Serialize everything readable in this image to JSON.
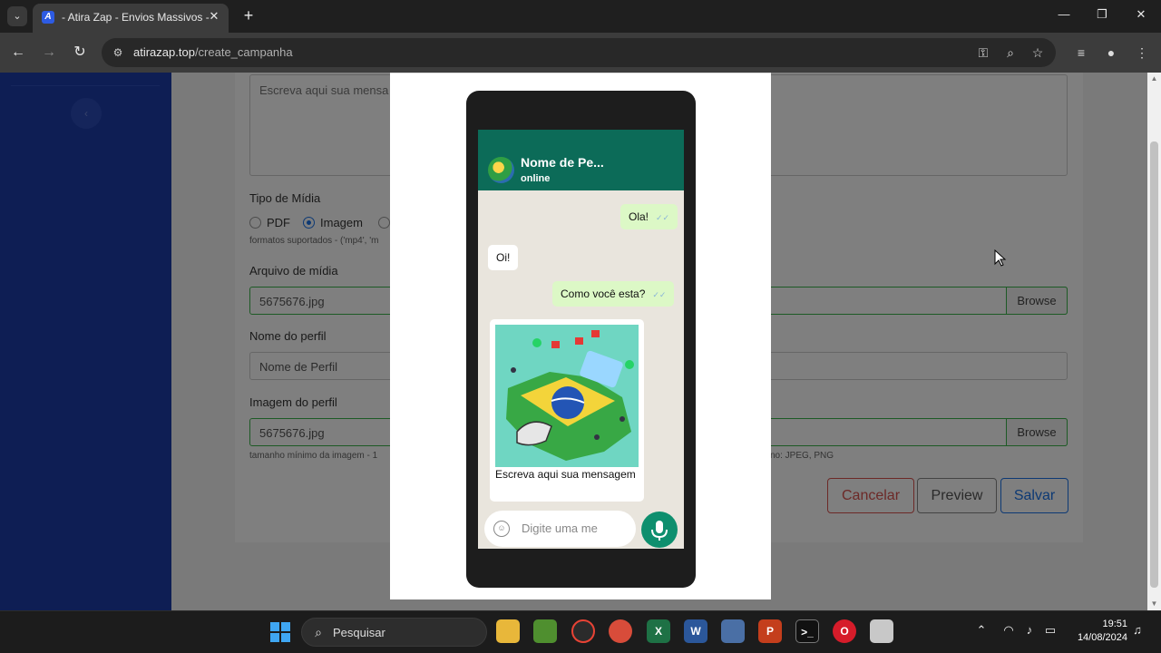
{
  "browser": {
    "tab_title": "- Atira Zap - Envios Massivos -",
    "url_host": "atirazap.top",
    "url_path": "/create_campanha"
  },
  "form": {
    "message_placeholder": "Escreva aqui sua mensa",
    "media_type_label": "Tipo de Mídia",
    "media_options": [
      "PDF",
      "Imagem"
    ],
    "media_selected": "Imagem",
    "formats_hint": "formatos suportados - ('mp4', 'm",
    "media_file_label": "Arquivo de mídia",
    "media_file_value": "5675676.jpg",
    "browse_label": "Browse",
    "profile_name_label": "Nome do perfil",
    "profile_name_value": "Nome de Perfil",
    "profile_image_label": "Imagem do perfil",
    "profile_image_value": "5675676.jpg",
    "image_size_hint": "tamanho mínimo da imagem - 1",
    "image_format_hint": "no: JPEG, PNG",
    "cancel_label": "Cancelar",
    "preview_label": "Preview",
    "save_label": "Salvar"
  },
  "preview": {
    "contact_name": "Nome de Pe...",
    "contact_status": "online",
    "messages": [
      {
        "dir": "out",
        "text": "Ola!"
      },
      {
        "dir": "in",
        "text": "Oi!"
      },
      {
        "dir": "out",
        "text": "Como você esta?"
      }
    ],
    "image_caption": "Escreva aqui sua mensagem",
    "input_placeholder": "Digite uma me"
  },
  "taskbar": {
    "search_label": "Pesquisar",
    "time": "19:51",
    "date": "14/08/2024"
  },
  "colors": {
    "sidebar": "#1d3da8",
    "wa_header": "#0c6b58",
    "wa_outgoing": "#dcf8c6",
    "valid_green": "#3bb54a",
    "cancel_red": "#d9534f",
    "save_blue": "#1a73e8"
  }
}
